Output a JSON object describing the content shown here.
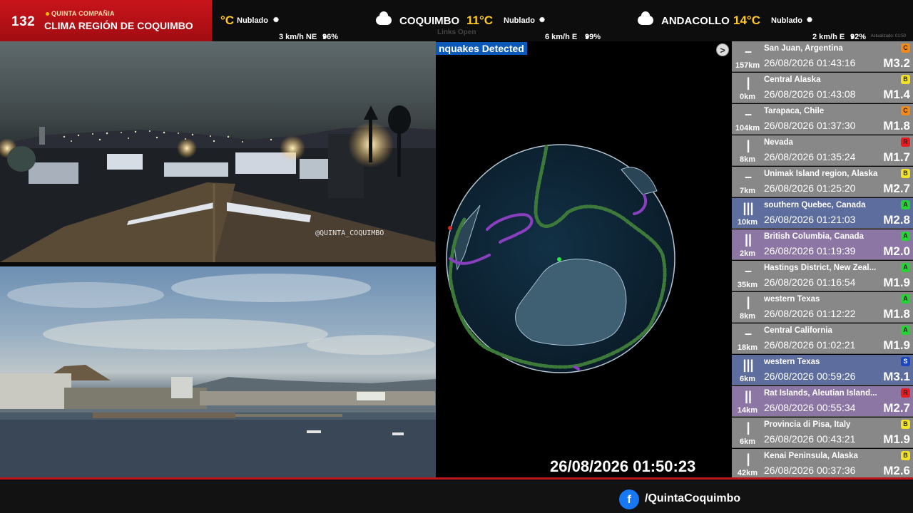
{
  "brand": {
    "number": "132",
    "subtitle": "QUINTA COMPAÑIA",
    "title": "CLIMA REGIÓN DE COQUIMBO"
  },
  "ticker": {
    "items": [
      {
        "city": "",
        "temp": "°C",
        "condition": "Nublado",
        "wind": "3 km/h NE",
        "humidity": "96%"
      },
      {
        "city": "COQUIMBO",
        "temp": "11°C",
        "condition": "Nublado",
        "wind": "6 km/h E",
        "humidity": "99%"
      },
      {
        "city": "ANDACOLLO",
        "temp": "14°C",
        "condition": "Nublado",
        "wind": "2 km/h E",
        "humidity": "92%"
      }
    ],
    "links": "Links  Open",
    "updated": "Actualizado: 01:50"
  },
  "cameras": {
    "cam1_watermark": "@QUINTA_COQUIMBO"
  },
  "globe": {
    "header": "nquakes Detected",
    "next_button": ">",
    "clock": "26/08/2026 01:50:23"
  },
  "quakes": [
    {
      "intensity": "–",
      "dist": "157km",
      "place": "San Juan, Argentina",
      "time": "26/08/2026 01:43:16",
      "mag": "M3.2",
      "badge": "C",
      "style": "gray"
    },
    {
      "intensity": "|",
      "dist": "0km",
      "place": "Central Alaska",
      "time": "26/08/2026 01:43:08",
      "mag": "M1.4",
      "badge": "B",
      "style": "gray"
    },
    {
      "intensity": "–",
      "dist": "104km",
      "place": "Tarapaca, Chile",
      "time": "26/08/2026 01:37:30",
      "mag": "M1.8",
      "badge": "C",
      "style": "gray"
    },
    {
      "intensity": "|",
      "dist": "8km",
      "place": "Nevada",
      "time": "26/08/2026 01:35:24",
      "mag": "M1.7",
      "badge": "R",
      "style": "gray"
    },
    {
      "intensity": "–",
      "dist": "7km",
      "place": "Unimak Island region, Alaska",
      "time": "26/08/2026 01:25:20",
      "mag": "M2.7",
      "badge": "B",
      "style": "gray"
    },
    {
      "intensity": "|||",
      "dist": "10km",
      "place": "southern Quebec, Canada",
      "time": "26/08/2026 01:21:03",
      "mag": "M2.8",
      "badge": "A",
      "style": "blue"
    },
    {
      "intensity": "||",
      "dist": "2km",
      "place": "British Columbia, Canada",
      "time": "26/08/2026 01:19:39",
      "mag": "M2.0",
      "badge": "A",
      "style": "purple"
    },
    {
      "intensity": "–",
      "dist": "35km",
      "place": "Hastings District, New Zeal...",
      "time": "26/08/2026 01:16:54",
      "mag": "M1.9",
      "badge": "A",
      "style": "gray"
    },
    {
      "intensity": "|",
      "dist": "8km",
      "place": "western Texas",
      "time": "26/08/2026 01:12:22",
      "mag": "M1.8",
      "badge": "A",
      "style": "gray"
    },
    {
      "intensity": "–",
      "dist": "18km",
      "place": "Central California",
      "time": "26/08/2026 01:02:21",
      "mag": "M1.9",
      "badge": "A",
      "style": "gray"
    },
    {
      "intensity": "|||",
      "dist": "6km",
      "place": "western Texas",
      "time": "26/08/2026 00:59:26",
      "mag": "M3.1",
      "badge": "S",
      "style": "blue"
    },
    {
      "intensity": "||",
      "dist": "14km",
      "place": "Rat Islands, Aleutian Island...",
      "time": "26/08/2026 00:55:34",
      "mag": "M2.7",
      "badge": "R",
      "style": "purple"
    },
    {
      "intensity": "|",
      "dist": "6km",
      "place": "Provincia di Pisa, Italy",
      "time": "26/08/2026 00:43:21",
      "mag": "M1.9",
      "badge": "B",
      "style": "gray"
    },
    {
      "intensity": "|",
      "dist": "42km",
      "place": "Kenai Peninsula, Alaska",
      "time": "26/08/2026 00:37:36",
      "mag": "M2.6",
      "badge": "B",
      "style": "gray"
    }
  ],
  "footer": {
    "facebook_handle": "/QuintaCoquimbo",
    "fb_letter": "f"
  },
  "colors": {
    "brand_red": "#c8141b",
    "temp_yellow": "#ffc81e",
    "badge_A": "#27d137",
    "badge_B": "#f2e326",
    "badge_C": "#f08a1d",
    "badge_R": "#e51d23",
    "badge_S": "#1c45c0"
  }
}
